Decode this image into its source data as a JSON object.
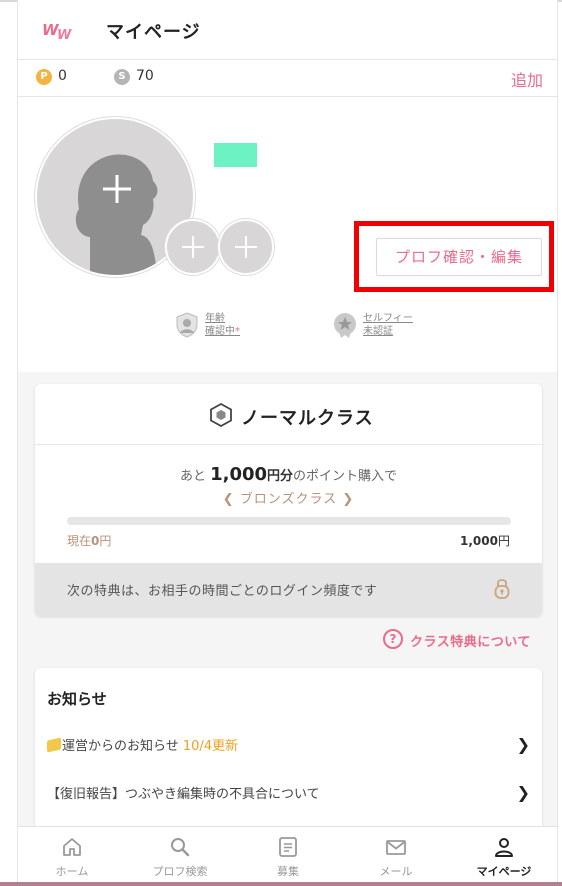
{
  "header": {
    "title": "マイページ"
  },
  "points": {
    "p_value": "0",
    "s_value": "70",
    "add_label": "追加",
    "p_icon": "P",
    "s_icon": "S"
  },
  "profile": {
    "edit_button": "プロフ確認・編集",
    "age_verify": [
      "年齢",
      "確認中"
    ],
    "age_mark": "*",
    "selfie_verify": [
      "セルフィー",
      "未認証"
    ]
  },
  "class_card": {
    "title": "ノーマルクラス",
    "promo_prefix": "あと",
    "promo_amount": "1,000",
    "promo_unit": "円分",
    "promo_suffix": "のポイント購入で",
    "next_class": "ブロンズクラス",
    "current_prefix": "現在",
    "current_amount": "0",
    "current_unit": "円",
    "goal_amount": "1,000",
    "goal_unit": "円",
    "benefit": "次の特典は、お相手の時間ごとのログイン頻度です",
    "progress": 0
  },
  "benefit_link": "クラス特典について",
  "news": {
    "title": "お知らせ",
    "items": [
      {
        "text": "運営からのお知らせ",
        "updated": "10/4更新"
      },
      {
        "text": "【復旧報告】つぶやき編集時の不具合について",
        "updated": ""
      }
    ]
  },
  "nav": {
    "items": [
      {
        "label": "ホーム",
        "icon": "home-icon"
      },
      {
        "label": "プロフ検索",
        "icon": "search-icon"
      },
      {
        "label": "募集",
        "icon": "list-icon"
      },
      {
        "label": "メール",
        "icon": "mail-icon"
      },
      {
        "label": "マイページ",
        "icon": "user-icon"
      }
    ],
    "active": 4
  },
  "colors": {
    "accent": "#e96b8a",
    "bronze": "#b8927a",
    "highlight": "#f00000",
    "name_block": "#6cf2c3"
  }
}
